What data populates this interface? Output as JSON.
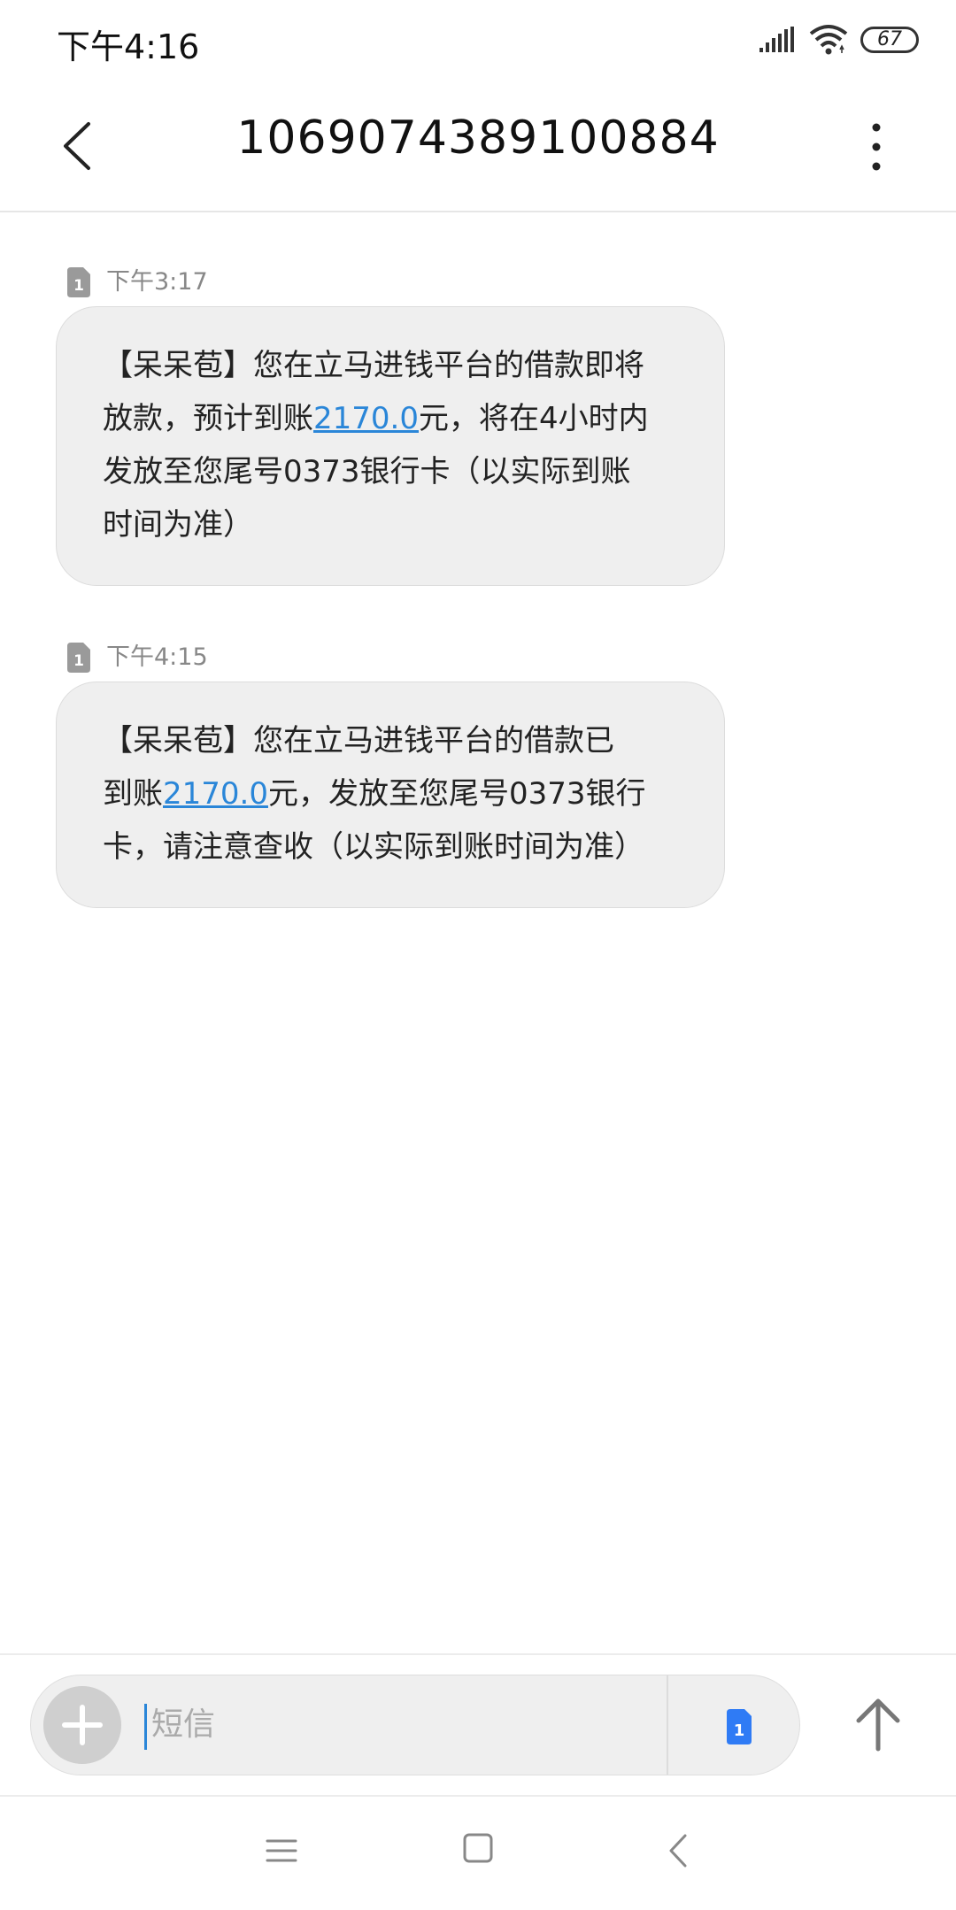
{
  "status_bar": {
    "time": "下午4:16",
    "battery_level": "67",
    "icons": [
      "signal-icon",
      "wifi-icon",
      "battery-icon"
    ]
  },
  "header": {
    "title": "1069074389100884",
    "icons": [
      "back-arrow-icon",
      "more-vertical-icon"
    ]
  },
  "messages": [
    {
      "sim": "1",
      "time": "下午3:17",
      "lines": [
        {
          "before": "【呆呆苞】您在立马进钱平台的借款即将"
        },
        {
          "before": "放款，预计到账",
          "link": "2170.0",
          "after": "元，将在4小时内"
        },
        {
          "before": "发放至您尾号0373银行卡（以实际到账"
        },
        {
          "before": "时间为准）"
        }
      ]
    },
    {
      "sim": "1",
      "time": "下午4:15",
      "lines": [
        {
          "before": "【呆呆苞】您在立马进钱平台的借款已"
        },
        {
          "before": "到账",
          "link": "2170.0",
          "after": "元，发放至您尾号0373银行"
        },
        {
          "before": "卡，请注意查收（以实际到账时间为准）"
        }
      ]
    }
  ],
  "composer": {
    "placeholder": "短信",
    "sim_label": "1",
    "icons": [
      "plus-icon",
      "sim-card-icon",
      "send-arrow-icon"
    ]
  },
  "nav_bar": {
    "icons": [
      "menu-icon",
      "home-icon",
      "back-icon"
    ]
  },
  "colors": {
    "link": "#2a86d8",
    "bubble_bg": "#efefef",
    "sim_badge_blue": "#2f7bf5",
    "sim_icon_gray": "#9a9a9a"
  }
}
